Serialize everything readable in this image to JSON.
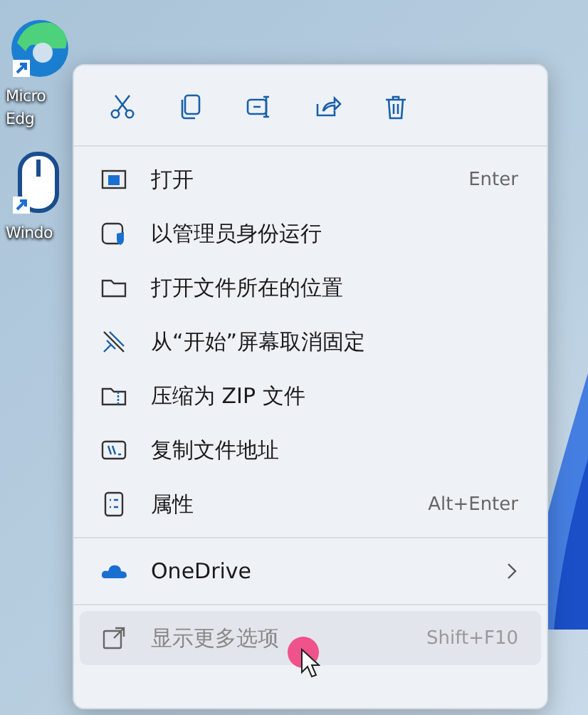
{
  "desktop_icons": [
    {
      "label_lines": [
        "Micro",
        "Edg"
      ]
    },
    {
      "label_lines": [
        "Windo"
      ]
    }
  ],
  "context_menu": {
    "sections": [
      {
        "items": [
          {
            "label": "打开",
            "shortcut": "Enter",
            "submenu": false,
            "selected": false
          },
          {
            "label": "以管理员身份运行",
            "submenu": false,
            "selected": false
          },
          {
            "label": "打开文件所在的位置",
            "submenu": false,
            "selected": false
          },
          {
            "label": "从“开始”屏幕取消固定",
            "submenu": false,
            "selected": false
          },
          {
            "label": "压缩为 ZIP 文件",
            "submenu": false,
            "selected": false
          },
          {
            "label": "复制文件地址",
            "submenu": false,
            "selected": false
          },
          {
            "label": "属性",
            "shortcut": "Alt+Enter",
            "submenu": false,
            "selected": false
          }
        ]
      },
      {
        "items": [
          {
            "label": "OneDrive",
            "submenu": true,
            "selected": false
          }
        ]
      },
      {
        "items": [
          {
            "label": "显示更多选项",
            "shortcut": "Shift+F10",
            "submenu": false,
            "selected": true
          }
        ]
      }
    ]
  }
}
